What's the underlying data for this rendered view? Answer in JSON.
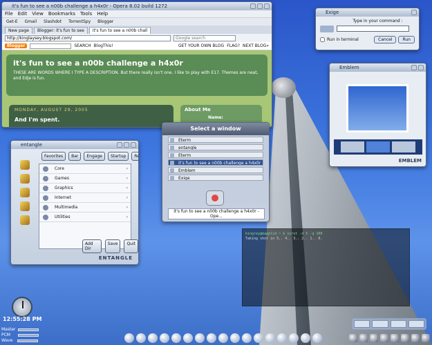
{
  "opera": {
    "title": "it's fun to see a n00b challenge a h4x0r - Opera 8.02 build 1272",
    "menu": [
      "File",
      "Edit",
      "View",
      "Bookmarks",
      "Tools",
      "Help"
    ],
    "bookmarks": [
      "Get-E",
      "Gmail",
      "Slashdot",
      "TorrentSpy",
      "Blogger"
    ],
    "tabs": [
      "New page",
      "Blogger: it's fun to see",
      "it's fun to see a n00b chall"
    ],
    "url": "http://kinglaysey.blogspot.com/",
    "search_placeholder": "Google search",
    "blogger": {
      "logo": "Blogger",
      "search_btn": "SEARCH",
      "blogthis": "BlogThis!",
      "get_own": "GET YOUR OWN BLOG",
      "flag": "FLAG?",
      "next": "NEXT BLOG»"
    },
    "blog": {
      "title": "it's fun to see a n00b challenge a h4x0r",
      "description": "THESE ARE WORDS WHERE I TYPE A DESCRIPTION. But there really isn't one. I like to play with E17. Themes are neat, and Edje is fun.",
      "date": "MONDAY, AUGUST 29, 2005",
      "post_title": "And I'm spent.",
      "about": "About Me",
      "name_label": "Name:"
    }
  },
  "exige": {
    "title": "Exige",
    "prompt": "Type in your command :",
    "run_in_terminal": "Run in terminal",
    "cancel": "Cancel",
    "run": "Run"
  },
  "emblem": {
    "title": "Emblem",
    "logo": "EMBLEM"
  },
  "select": {
    "title": "Select a window",
    "items": [
      "Eterm",
      "entangle",
      "Eterm",
      "it's fun to see a n00b challenge a h4x0r - Ope",
      "Emblem",
      "Exige"
    ],
    "caption": "it's fun to see a n00b challenge a h4x0r - Ope..."
  },
  "entangle": {
    "title": "entangle",
    "top_buttons": [
      "Favorites",
      "Bar",
      "Engage",
      "Startup",
      "Restart"
    ],
    "items": [
      "Core",
      "Games",
      "Graphics",
      "Internet",
      "Multimedia",
      "Utilities"
    ],
    "bottom_buttons": [
      "Add Dir",
      "Save",
      "Quit"
    ],
    "logo": "ENTANGLE"
  },
  "terminal": {
    "lines": [
      "kingrey@mapplid ~ $ scrot -d 5 -q 100",
      "Taking shot in 5.. 4.. 3.. 2.. 1.. 0."
    ]
  },
  "clock": {
    "time": "12:55:28 PM"
  },
  "mixer": {
    "channels": [
      "Master",
      "PCM",
      "Wave"
    ]
  }
}
